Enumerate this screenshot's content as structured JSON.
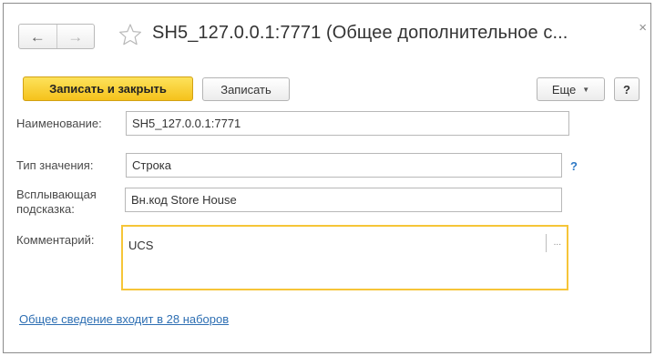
{
  "window": {
    "title": "SH5_127.0.0.1:7771 (Общее дополнительное с...",
    "close_glyph": "×"
  },
  "nav": {
    "back_glyph": "←",
    "forward_glyph": "→"
  },
  "toolbar": {
    "save_and_close_label": "Записать и закрыть",
    "save_label": "Записать",
    "more_label": "Еще",
    "help_label": "?"
  },
  "form": {
    "name_label": "Наименование:",
    "name_value": "SH5_127.0.0.1:7771",
    "value_type_label": "Тип значения:",
    "value_type_value": "Строка",
    "value_type_help": "?",
    "tooltip_label_line1": "Всплывающая",
    "tooltip_label_line2": "подсказка:",
    "tooltip_value": "Вн.код Store House",
    "comment_label": "Комментарий:",
    "comment_value": "UCS",
    "comment_button_glyph": "..."
  },
  "footer": {
    "sets_link": "Общее сведение входит в 28 наборов"
  },
  "colors": {
    "primary_button": "#f5c21b",
    "focus_border": "#f6c538",
    "link": "#2e6fb3"
  },
  "icons": {
    "favorite": "star-icon",
    "more_dropdown": "chevron-down-icon"
  }
}
